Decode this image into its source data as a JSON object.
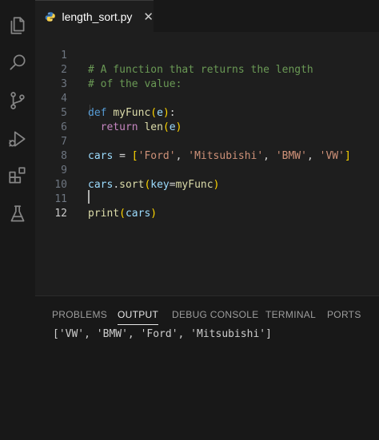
{
  "activity_bar": {
    "icons": [
      "explorer-icon",
      "search-icon",
      "source-control-icon",
      "run-debug-icon",
      "extensions-icon",
      "testing-icon"
    ]
  },
  "tabs": [
    {
      "label": "length_sort.py",
      "icon": "python-file-icon",
      "close": "✕"
    }
  ],
  "editor": {
    "line_numbers": [
      "1",
      "2",
      "3",
      "4",
      "5",
      "6",
      "7",
      "8",
      "9",
      "10",
      "11",
      "12"
    ],
    "active_line": "12",
    "code": {
      "l1": "# A function that returns the length",
      "l2": "# of the value:",
      "l4_def": "def",
      "l4_name": "myFunc",
      "l4_param": "e",
      "l5_return": "return",
      "l5_call": "len",
      "l5_arg": "e",
      "l7_var": "cars",
      "l7_items": [
        "'Ford'",
        "'Mitsubishi'",
        "'BMW'",
        "'VW'"
      ],
      "l9_var": "cars",
      "l9_method": "sort",
      "l9_kw": "key",
      "l9_val": "myFunc",
      "l11_func": "print",
      "l11_arg": "cars"
    }
  },
  "panel": {
    "tabs": [
      "PROBLEMS",
      "OUTPUT",
      "DEBUG CONSOLE",
      "TERMINAL",
      "PORTS"
    ],
    "active_tab": "OUTPUT",
    "output": "['VW', 'BMW', 'Ford', 'Mitsubishi']"
  }
}
